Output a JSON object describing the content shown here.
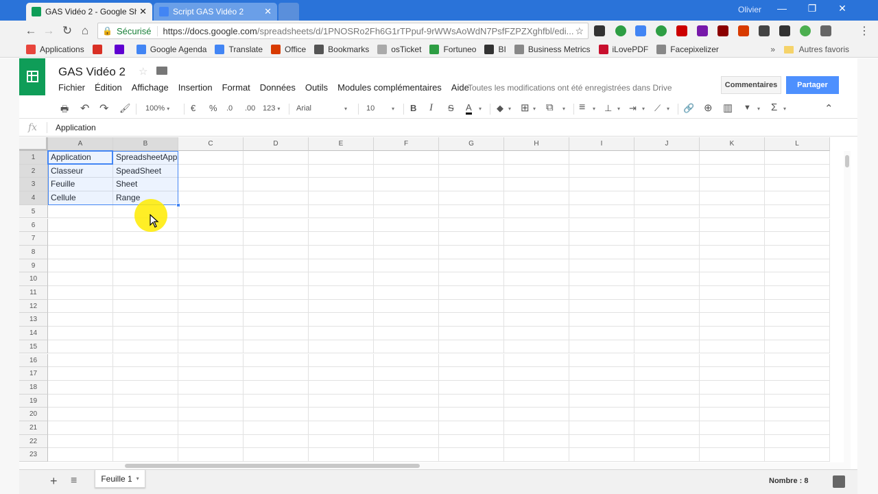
{
  "browser": {
    "tabs": [
      {
        "title": "GAS Vidéo 2 - Google Sh",
        "favicon_color": "#0f9d58",
        "active": true
      },
      {
        "title": "Script GAS Vidéo 2",
        "favicon_color": "#4285f4",
        "active": false
      }
    ],
    "close_glyph": "✕",
    "user": "Olivier",
    "window_controls": {
      "minimize": "—",
      "restore": "❐",
      "close": "✕"
    },
    "nav": {
      "back": "←",
      "forward": "→",
      "reload": "↻",
      "home": "⌂"
    },
    "omnibox": {
      "lock_glyph": "🔒",
      "secure_label": "Sécurisé",
      "url_host": "https://docs.google.com",
      "url_path": "/spreadsheets/d/1PNOSRo2Fh6G1rTPpuf-9rWWsAoWdN7PsfFZPZXghfbl/edi...",
      "star_glyph": "☆"
    },
    "bookmarks": [
      {
        "label": "Applications",
        "icon": "apps-grid-icon",
        "color": "#e8453c"
      },
      {
        "label": "",
        "icon": "gmail-icon",
        "color": "#d93025"
      },
      {
        "label": "",
        "icon": "yahoo-icon",
        "color": "#5f01d1"
      },
      {
        "label": "Google Agenda",
        "icon": "calendar-icon",
        "color": "#4285f4"
      },
      {
        "label": "Translate",
        "icon": "translate-icon",
        "color": "#4285f4"
      },
      {
        "label": "Office",
        "icon": "office-icon",
        "color": "#d83b01"
      },
      {
        "label": "Bookmarks",
        "icon": "star-icon",
        "color": "#555555"
      },
      {
        "label": "osTicket",
        "icon": "ticket-icon",
        "color": "#aaaaaa"
      },
      {
        "label": "Fortuneo",
        "icon": "fortuneo-icon",
        "color": "#2e9e44"
      },
      {
        "label": "BI",
        "icon": "bi-icon",
        "color": "#333333"
      },
      {
        "label": "Business Metrics",
        "icon": "page-icon",
        "color": "#888888"
      },
      {
        "label": "iLovePDF",
        "icon": "heart-icon",
        "color": "#c8102e"
      },
      {
        "label": "Facepixelizer",
        "icon": "page-icon",
        "color": "#888888"
      }
    ],
    "bookmarks_more": "»",
    "bookmarks_other": "Autres favoris"
  },
  "sheets": {
    "doc_title": "GAS Vidéo 2",
    "star_glyph": "☆",
    "menu": [
      "Fichier",
      "Édition",
      "Affichage",
      "Insertion",
      "Format",
      "Données",
      "Outils",
      "Modules complémentaires",
      "Aide"
    ],
    "save_status": "Toutes les modifications ont été enregistrées dans Drive",
    "comments_label": "Commentaires",
    "share_label": "Partager",
    "toolbar": {
      "print": "🖶",
      "undo": "↶",
      "redo": "↷",
      "paint_format": "🖌",
      "zoom": "100%",
      "currency": "€",
      "percent": "%",
      "dec_less": ".0",
      "dec_more": ".00",
      "more_formats": "123",
      "font": "Arial",
      "font_size": "10",
      "bold": "B",
      "italic": "I",
      "strike": "S",
      "text_color": "A",
      "fill": "◆",
      "borders": "⊞",
      "merge": "⧉",
      "align": "≡",
      "valign": "⊥",
      "wrap": "⇥",
      "rotate": "⟋",
      "link": "🔗",
      "comment": "⊕",
      "chart": "▥",
      "filter": "▼",
      "functions": "Σ",
      "collapse": "⌃",
      "caret": "▾"
    },
    "formula_bar": {
      "fx": "fx",
      "value": "Application"
    },
    "columns": [
      "A",
      "B",
      "C",
      "D",
      "E",
      "F",
      "G",
      "H",
      "I",
      "J",
      "K",
      "L"
    ],
    "rows": [
      "1",
      "2",
      "3",
      "4",
      "5",
      "6",
      "7",
      "8",
      "9",
      "10",
      "11",
      "12",
      "13",
      "14",
      "15",
      "16",
      "17",
      "18",
      "19",
      "20",
      "21",
      "22",
      "23"
    ],
    "cells": [
      [
        "Application",
        "SpreadsheetApp"
      ],
      [
        "Classeur",
        "SpeadSheet"
      ],
      [
        "Feuille",
        "Sheet"
      ],
      [
        "Cellule",
        "Range"
      ]
    ],
    "selected_range": "A1:B4",
    "cursor_glyph": "➤",
    "sheet_tab": "Feuille 1",
    "add_sheet": "+",
    "all_sheets": "≡",
    "status": "Nombre : 8",
    "colors": {
      "accent": "#4285f4",
      "sheets_green": "#0f9d58",
      "share_blue": "#4d90fe"
    }
  }
}
